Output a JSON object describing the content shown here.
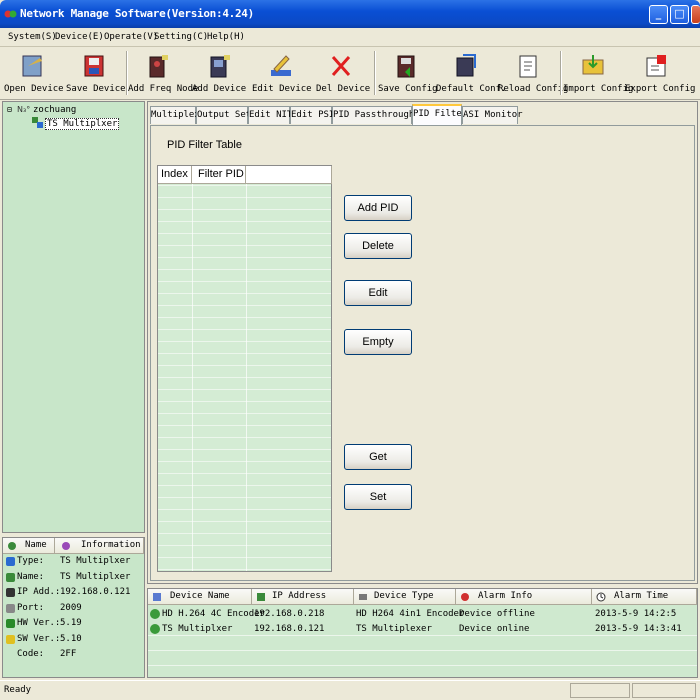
{
  "window": {
    "title": "Network Manage Software(Version:4.24)",
    "minimize": "_",
    "maximize": "□",
    "close": "✕"
  },
  "menu": [
    "System(S)",
    "Device(E)",
    "Operate(V)",
    "Setting(C)",
    "Help(H)"
  ],
  "toolbar": {
    "open_device": "Open Device",
    "save_device": "Save Device",
    "add_freq_node": "Add Freq Node",
    "add_device": "Add Device",
    "edit_device": "Edit Device",
    "del_device": "Del Device",
    "save_config": "Save Config",
    "default_conf": "Default Conf.",
    "reload_config": "Reload Config",
    "import_config": "Import Config",
    "export_config": "Export Config"
  },
  "tree": {
    "root": "zochuang",
    "child": "TS Multiplxer"
  },
  "info_panel": {
    "headers": {
      "name": "Name",
      "information": "Information"
    },
    "rows": [
      {
        "label": "Type:",
        "value": "TS Multiplxer"
      },
      {
        "label": "Name:",
        "value": "TS Multiplxer"
      },
      {
        "label": "IP Add.:",
        "value": "192.168.0.121"
      },
      {
        "label": "Port:",
        "value": "2009"
      },
      {
        "label": "HW Ver.:",
        "value": "5.19"
      },
      {
        "label": "SW Ver.:",
        "value": "5.10"
      },
      {
        "label": "Code:",
        "value": "2FF"
      }
    ]
  },
  "tabs": [
    "Multiplex",
    "Output Set",
    "Edit NIT",
    "Edit PSI",
    "PID Passthrough",
    "PID Filter",
    "ASI Monitor"
  ],
  "active_tab": "PID Filter",
  "pid_filter": {
    "title": "PID Filter Table",
    "columns": [
      "Index",
      "Filter PID"
    ],
    "buttons": {
      "add": "Add PID",
      "delete": "Delete",
      "edit": "Edit",
      "empty": "Empty",
      "get": "Get",
      "set": "Set"
    }
  },
  "device_list": {
    "columns": [
      "Device Name",
      "IP Address",
      "Device Type",
      "Alarm Info",
      "Alarm Time"
    ],
    "rows": [
      {
        "name": "HD H.264 4C Encoder",
        "ip": "192.168.0.218",
        "type": "HD H264 4in1 Encoder",
        "alarm": "Device offline",
        "time": "2013-5-9 14:2:5"
      },
      {
        "name": "TS Multiplxer",
        "ip": "192.168.0.121",
        "type": "TS Multiplexer",
        "alarm": "Device online",
        "time": "2013-5-9 14:3:41"
      }
    ]
  },
  "status": {
    "text": "Ready"
  },
  "colors": {
    "titlebar": "#0a4fd4",
    "panel_green": "#c8e6c9",
    "tab_highlight": "#ffc83c"
  }
}
